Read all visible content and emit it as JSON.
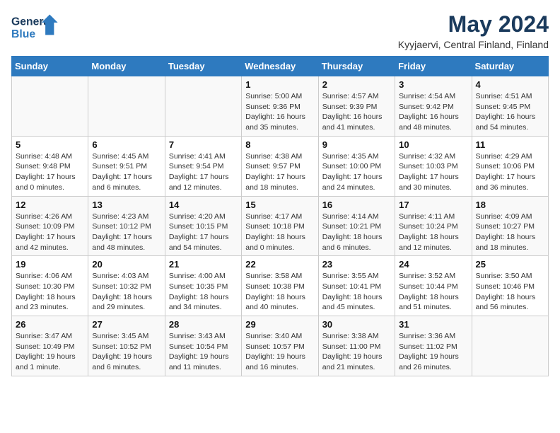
{
  "header": {
    "logo_line1": "General",
    "logo_line2": "Blue",
    "title": "May 2024",
    "subtitle": "Kyyjaervi, Central Finland, Finland"
  },
  "days_of_week": [
    "Sunday",
    "Monday",
    "Tuesday",
    "Wednesday",
    "Thursday",
    "Friday",
    "Saturday"
  ],
  "weeks": [
    [
      {
        "day": "",
        "info": ""
      },
      {
        "day": "",
        "info": ""
      },
      {
        "day": "",
        "info": ""
      },
      {
        "day": "1",
        "info": "Sunrise: 5:00 AM\nSunset: 9:36 PM\nDaylight: 16 hours and 35 minutes."
      },
      {
        "day": "2",
        "info": "Sunrise: 4:57 AM\nSunset: 9:39 PM\nDaylight: 16 hours and 41 minutes."
      },
      {
        "day": "3",
        "info": "Sunrise: 4:54 AM\nSunset: 9:42 PM\nDaylight: 16 hours and 48 minutes."
      },
      {
        "day": "4",
        "info": "Sunrise: 4:51 AM\nSunset: 9:45 PM\nDaylight: 16 hours and 54 minutes."
      }
    ],
    [
      {
        "day": "5",
        "info": "Sunrise: 4:48 AM\nSunset: 9:48 PM\nDaylight: 17 hours and 0 minutes."
      },
      {
        "day": "6",
        "info": "Sunrise: 4:45 AM\nSunset: 9:51 PM\nDaylight: 17 hours and 6 minutes."
      },
      {
        "day": "7",
        "info": "Sunrise: 4:41 AM\nSunset: 9:54 PM\nDaylight: 17 hours and 12 minutes."
      },
      {
        "day": "8",
        "info": "Sunrise: 4:38 AM\nSunset: 9:57 PM\nDaylight: 17 hours and 18 minutes."
      },
      {
        "day": "9",
        "info": "Sunrise: 4:35 AM\nSunset: 10:00 PM\nDaylight: 17 hours and 24 minutes."
      },
      {
        "day": "10",
        "info": "Sunrise: 4:32 AM\nSunset: 10:03 PM\nDaylight: 17 hours and 30 minutes."
      },
      {
        "day": "11",
        "info": "Sunrise: 4:29 AM\nSunset: 10:06 PM\nDaylight: 17 hours and 36 minutes."
      }
    ],
    [
      {
        "day": "12",
        "info": "Sunrise: 4:26 AM\nSunset: 10:09 PM\nDaylight: 17 hours and 42 minutes."
      },
      {
        "day": "13",
        "info": "Sunrise: 4:23 AM\nSunset: 10:12 PM\nDaylight: 17 hours and 48 minutes."
      },
      {
        "day": "14",
        "info": "Sunrise: 4:20 AM\nSunset: 10:15 PM\nDaylight: 17 hours and 54 minutes."
      },
      {
        "day": "15",
        "info": "Sunrise: 4:17 AM\nSunset: 10:18 PM\nDaylight: 18 hours and 0 minutes."
      },
      {
        "day": "16",
        "info": "Sunrise: 4:14 AM\nSunset: 10:21 PM\nDaylight: 18 hours and 6 minutes."
      },
      {
        "day": "17",
        "info": "Sunrise: 4:11 AM\nSunset: 10:24 PM\nDaylight: 18 hours and 12 minutes."
      },
      {
        "day": "18",
        "info": "Sunrise: 4:09 AM\nSunset: 10:27 PM\nDaylight: 18 hours and 18 minutes."
      }
    ],
    [
      {
        "day": "19",
        "info": "Sunrise: 4:06 AM\nSunset: 10:30 PM\nDaylight: 18 hours and 23 minutes."
      },
      {
        "day": "20",
        "info": "Sunrise: 4:03 AM\nSunset: 10:32 PM\nDaylight: 18 hours and 29 minutes."
      },
      {
        "day": "21",
        "info": "Sunrise: 4:00 AM\nSunset: 10:35 PM\nDaylight: 18 hours and 34 minutes."
      },
      {
        "day": "22",
        "info": "Sunrise: 3:58 AM\nSunset: 10:38 PM\nDaylight: 18 hours and 40 minutes."
      },
      {
        "day": "23",
        "info": "Sunrise: 3:55 AM\nSunset: 10:41 PM\nDaylight: 18 hours and 45 minutes."
      },
      {
        "day": "24",
        "info": "Sunrise: 3:52 AM\nSunset: 10:44 PM\nDaylight: 18 hours and 51 minutes."
      },
      {
        "day": "25",
        "info": "Sunrise: 3:50 AM\nSunset: 10:46 PM\nDaylight: 18 hours and 56 minutes."
      }
    ],
    [
      {
        "day": "26",
        "info": "Sunrise: 3:47 AM\nSunset: 10:49 PM\nDaylight: 19 hours and 1 minute."
      },
      {
        "day": "27",
        "info": "Sunrise: 3:45 AM\nSunset: 10:52 PM\nDaylight: 19 hours and 6 minutes."
      },
      {
        "day": "28",
        "info": "Sunrise: 3:43 AM\nSunset: 10:54 PM\nDaylight: 19 hours and 11 minutes."
      },
      {
        "day": "29",
        "info": "Sunrise: 3:40 AM\nSunset: 10:57 PM\nDaylight: 19 hours and 16 minutes."
      },
      {
        "day": "30",
        "info": "Sunrise: 3:38 AM\nSunset: 11:00 PM\nDaylight: 19 hours and 21 minutes."
      },
      {
        "day": "31",
        "info": "Sunrise: 3:36 AM\nSunset: 11:02 PM\nDaylight: 19 hours and 26 minutes."
      },
      {
        "day": "",
        "info": ""
      }
    ]
  ]
}
